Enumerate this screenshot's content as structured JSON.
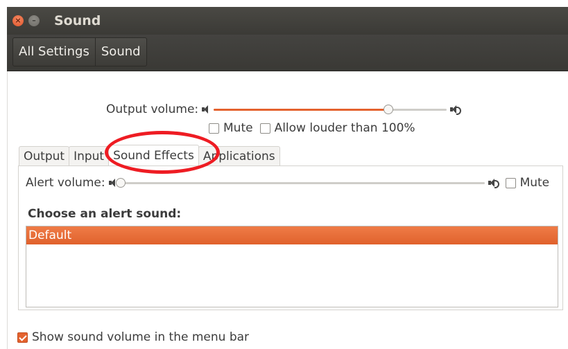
{
  "window": {
    "title": "Sound",
    "close_glyph": "×",
    "minimize_glyph": "–"
  },
  "breadcrumb": {
    "items": [
      {
        "label": "All Settings"
      },
      {
        "label": "Sound"
      }
    ]
  },
  "output": {
    "label": "Output volume:",
    "volume_fraction": 0.75,
    "mute_label": "Mute",
    "mute_checked": false,
    "allow_louder_label": "Allow louder than 100%",
    "allow_louder_checked": false
  },
  "tabs": [
    {
      "label": "Output",
      "active": false
    },
    {
      "label": "Input",
      "active": false
    },
    {
      "label": "Sound Effects",
      "active": true
    },
    {
      "label": "Applications",
      "active": false
    }
  ],
  "sound_effects": {
    "alert_label": "Alert volume:",
    "alert_fraction": 0.0,
    "mute_label": "Mute",
    "mute_checked": false,
    "choose_label": "Choose an alert sound:",
    "sounds": [
      {
        "label": "Default",
        "selected": true
      }
    ]
  },
  "footer": {
    "show_volume_label": "Show sound volume in the menu bar",
    "show_volume_checked": true
  },
  "colors": {
    "accent": "#e4622e",
    "titlebar": "#3c3b37",
    "annotation": "#ee1c23"
  }
}
